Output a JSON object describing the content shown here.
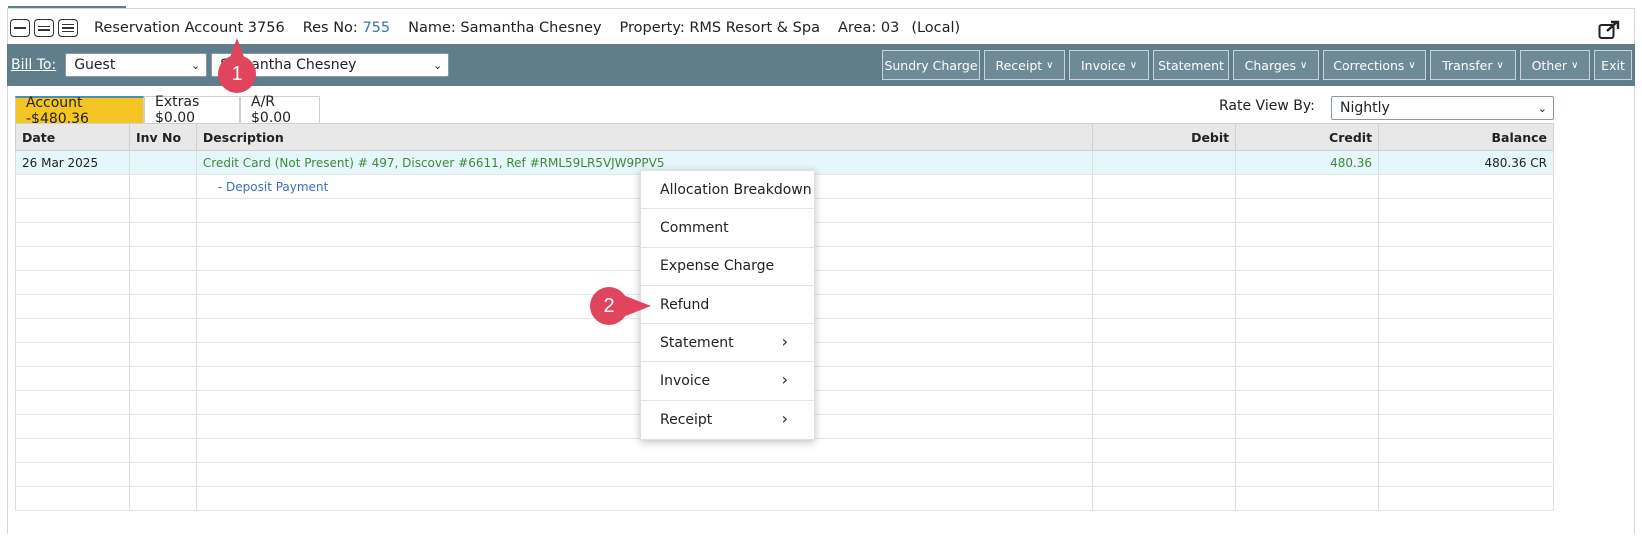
{
  "header": {
    "title": "Reservation Account 3756",
    "res_label": "Res No:",
    "res_no": "755",
    "name": "Name: Samantha Chesney",
    "property": "Property: RMS Resort & Spa",
    "area": "Area: 03",
    "local": "(Local)"
  },
  "toolbar": {
    "bill_to": "Bill To:",
    "bill_to_type": "Guest",
    "bill_to_name": "Samantha Chesney",
    "buttons": {
      "sundry": "Sundry Charge",
      "receipt": "Receipt",
      "invoice": "Invoice",
      "statement": "Statement",
      "charges": "Charges",
      "corrections": "Corrections",
      "transfer": "Transfer",
      "other": "Other",
      "exit": "Exit"
    }
  },
  "tabs": [
    "Account -$480.36",
    "Extras $0.00",
    "A/R $0.00"
  ],
  "rate_view": {
    "label": "Rate View By:",
    "value": "Nightly"
  },
  "grid": {
    "columns": [
      "Date",
      "Inv No",
      "Description",
      "Debit",
      "Credit",
      "Balance"
    ],
    "rows": [
      {
        "date": "26 Mar 2025",
        "inv_no": "",
        "description": "Credit Card (Not Present) # 497, Discover #6611, Ref #RML59LR5VJW9PPV5",
        "debit": "",
        "credit": "480.36",
        "balance": "480.36 CR"
      },
      {
        "date": "",
        "inv_no": "",
        "description": "- Deposit Payment",
        "debit": "",
        "credit": "",
        "balance": ""
      }
    ]
  },
  "context_menu": [
    "Allocation Breakdown",
    "Comment",
    "Expense Charge",
    "Refund",
    "Statement",
    "Invoice",
    "Receipt"
  ],
  "callouts": [
    "1",
    "2"
  ],
  "colors": {
    "toolbar": "#5f7d8a",
    "active_tab": "#f5c623",
    "callout": "#e0455d",
    "credit_green": "#3c8a3c",
    "link_blue": "#3a6fc4"
  }
}
